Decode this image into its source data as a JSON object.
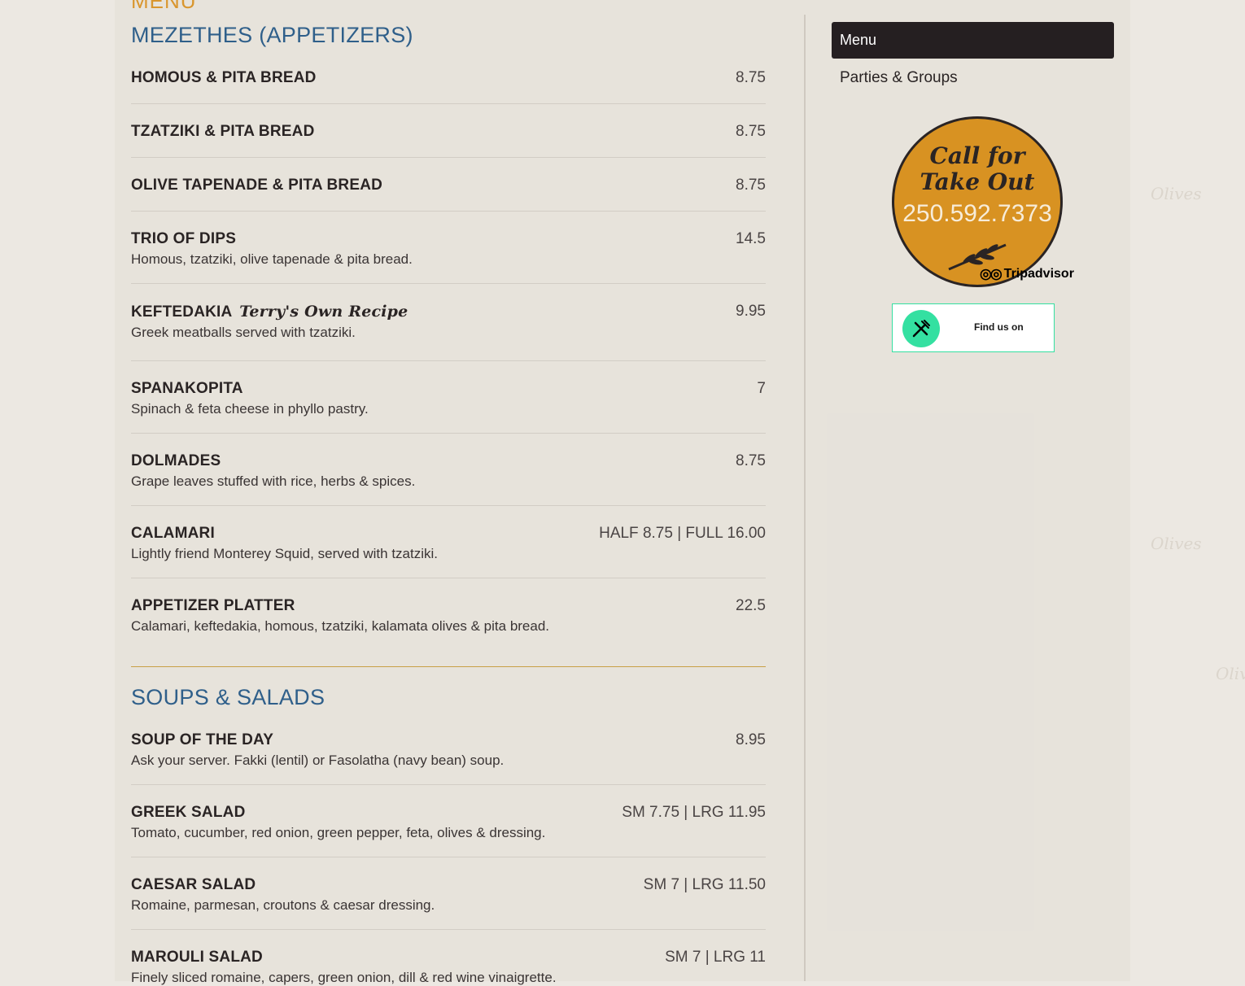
{
  "page": {
    "heading": "MENU"
  },
  "sections": [
    {
      "title": "MEZETHES (APPETIZERS)",
      "items": [
        {
          "name": "HOMOUS & PITA BREAD",
          "price": "8.75",
          "desc": ""
        },
        {
          "name": "TZATZIKI & PITA BREAD",
          "price": "8.75",
          "desc": ""
        },
        {
          "name": "OLIVE TAPENADE & PITA BREAD",
          "price": "8.75",
          "desc": ""
        },
        {
          "name": "TRIO OF DIPS",
          "price": "14.5",
          "desc": "Homous, tzatziki, olive tapenade & pita bread."
        },
        {
          "name": "KEFTEDAKIA",
          "note": "Terry's Own Recipe",
          "price": "9.95",
          "desc": "Greek meatballs served with tzatziki."
        },
        {
          "name": "SPANAKOPITA",
          "price": "7",
          "desc": "Spinach & feta cheese in phyllo pastry."
        },
        {
          "name": "DOLMADES",
          "price": "8.75",
          "desc": "Grape leaves stuffed with rice, herbs & spices."
        },
        {
          "name": "CALAMARI",
          "price": "HALF 8.75 | FULL 16.00",
          "desc": "Lightly friend Monterey Squid, served with tzatziki."
        },
        {
          "name": "APPETIZER PLATTER",
          "price": "22.5",
          "desc": "Calamari, keftedakia, homous, tzatziki, kalamata olives & pita bread."
        }
      ]
    },
    {
      "title": "SOUPS & SALADS",
      "items": [
        {
          "name": "SOUP OF THE DAY",
          "price": "8.95",
          "desc": "Ask your server. Fakki (lentil) or Fasolatha (navy bean) soup."
        },
        {
          "name": "GREEK SALAD",
          "price": "SM 7.75 | LRG 11.95",
          "desc": "Tomato, cucumber, red onion, green pepper, feta, olives & dressing."
        },
        {
          "name": "CAESAR SALAD",
          "price": "SM 7 | LRG 11.50",
          "desc": "Romaine, parmesan, croutons & caesar dressing."
        },
        {
          "name": "MAROULI SALAD",
          "price": "SM 7 | LRG 11",
          "desc": "Finely sliced romaine, capers, green onion, dill & red wine vinaigrette."
        }
      ]
    }
  ],
  "sidebar": {
    "nav": [
      {
        "label": "Menu",
        "active": true
      },
      {
        "label": "Parties & Groups",
        "active": false
      }
    ],
    "takeout": {
      "line1": "Call for",
      "line2": "Take Out",
      "phone": "250.592.7373"
    },
    "tripadvisor": {
      "label": "Tripadvisor"
    },
    "findus": {
      "label": "Find us on"
    }
  },
  "background": {
    "watermark": "Olives"
  },
  "colors": {
    "accent_blue": "#2f5f8a",
    "accent_gold": "#d89222",
    "nav_dark": "#251f21",
    "tripadvisor_green": "#34e0a1"
  }
}
